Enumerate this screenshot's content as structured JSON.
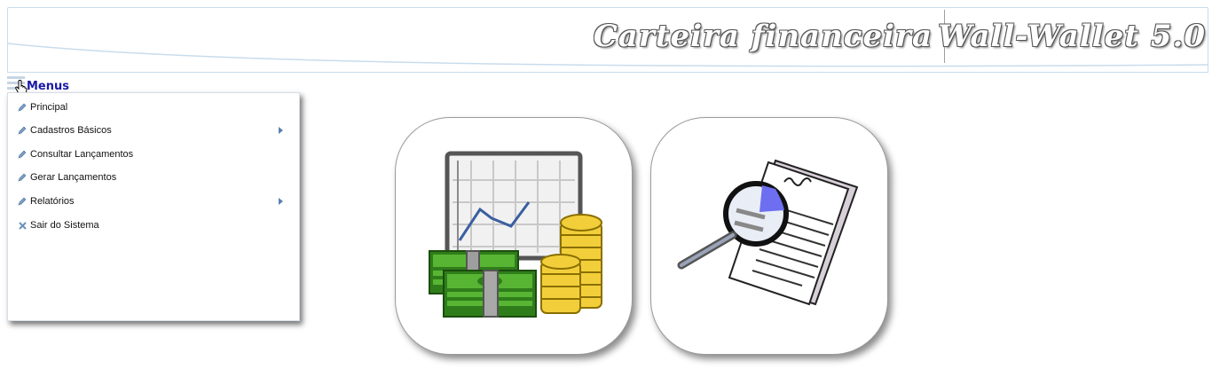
{
  "header": {
    "subtitle": "Carteira financeira",
    "app_name": "Wall-Wallet 5.0"
  },
  "menu": {
    "label": "Menus",
    "items": [
      {
        "label": "Principal",
        "icon": "pencil-icon",
        "has_submenu": false
      },
      {
        "label": "Cadastros Básicos",
        "icon": "pencil-icon",
        "has_submenu": true
      },
      {
        "label": "Consultar Lançamentos",
        "icon": "pencil-icon",
        "has_submenu": false
      },
      {
        "label": "Gerar Lançamentos",
        "icon": "pencil-icon",
        "has_submenu": false
      },
      {
        "label": "Relatórios",
        "icon": "pencil-icon",
        "has_submenu": true
      },
      {
        "label": "Sair do Sistema",
        "icon": "close-icon",
        "has_submenu": false
      }
    ]
  },
  "shortcuts": [
    {
      "icon": "finance-chart-money-icon"
    },
    {
      "icon": "report-magnifier-icon"
    }
  ],
  "colors": {
    "menu_label": "#1a1aa8",
    "banner_border": "#c9dcec",
    "menu_arrow": "#5b7fb0"
  }
}
